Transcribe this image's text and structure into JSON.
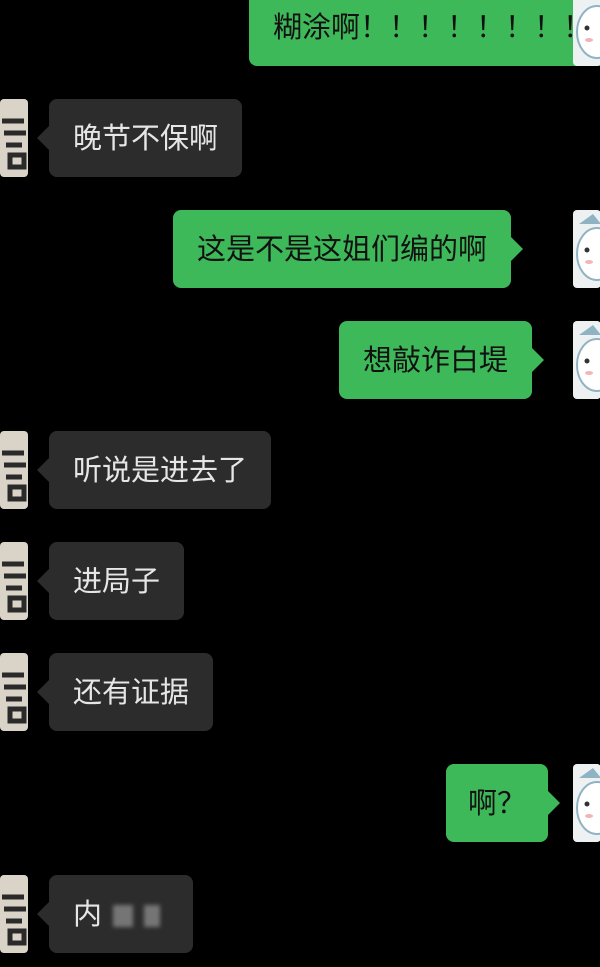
{
  "messages": [
    {
      "side": "out",
      "text": "糊涂啊！！！！！！！！"
    },
    {
      "side": "in",
      "text": "晚节不保啊"
    },
    {
      "side": "out",
      "text": "这是不是这姐们编的啊"
    },
    {
      "side": "out",
      "text": "想敲诈白堤"
    },
    {
      "side": "in",
      "text": "听说是进去了"
    },
    {
      "side": "in",
      "text": "进局子"
    },
    {
      "side": "in",
      "text": "还有证据"
    },
    {
      "side": "out",
      "text": "啊？"
    },
    {
      "side": "in",
      "text": "内"
    }
  ],
  "colors": {
    "background": "#000000",
    "incoming_bubble": "#2c2c2c",
    "outgoing_bubble": "#3eb95a"
  },
  "icons": {
    "left_avatar": "calligraphy-avatar-icon",
    "right_avatar": "cartoon-character-avatar-icon"
  }
}
